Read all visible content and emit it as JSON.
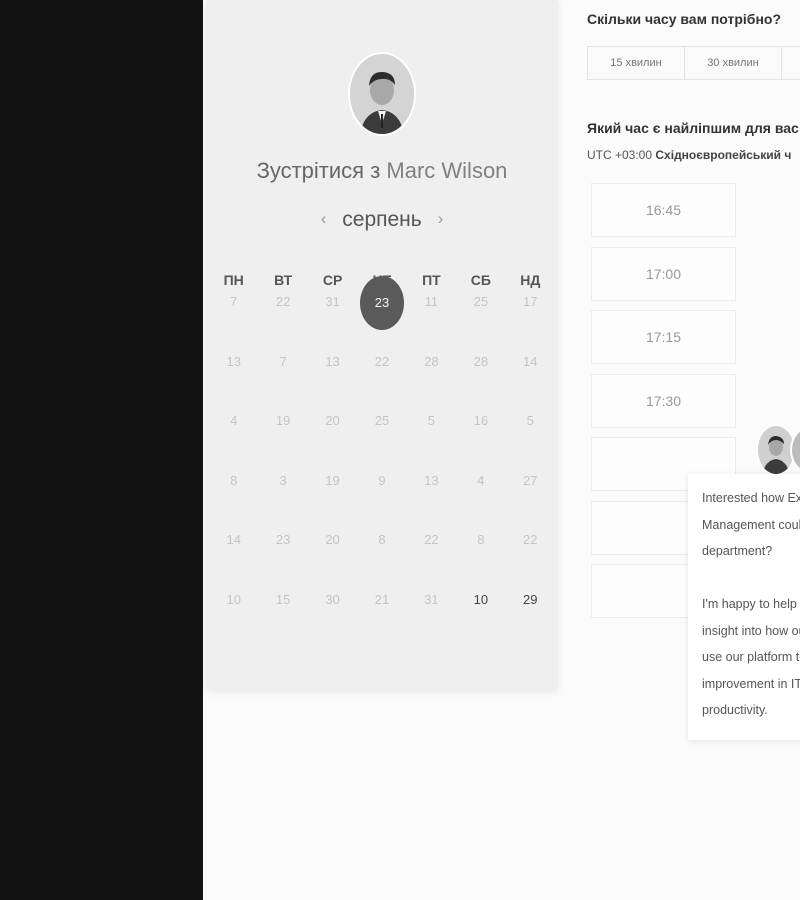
{
  "booking": {
    "title_prefix": "Зустрітися з",
    "host_name": "Marc Wilson",
    "month": "серпень",
    "prev_icon": "‹",
    "next_icon": "›"
  },
  "calendar": {
    "weekdays": [
      "ПН",
      "ВТ",
      "СР",
      "ЧТ",
      "ПТ",
      "СБ",
      "НД"
    ],
    "weeks": [
      [
        "7",
        "22",
        "31",
        "23",
        "11",
        "25",
        "17"
      ],
      [
        "13",
        "7",
        "13",
        "22",
        "28",
        "28",
        "14"
      ],
      [
        "4",
        "19",
        "20",
        "25",
        "5",
        "16",
        "5"
      ],
      [
        "8",
        "3",
        "19",
        "9",
        "13",
        "4",
        "27"
      ],
      [
        "14",
        "23",
        "20",
        "8",
        "22",
        "8",
        "22"
      ],
      [
        "10",
        "15",
        "30",
        "21",
        "31",
        "10",
        "29"
      ]
    ],
    "selected": "23"
  },
  "duration": {
    "question": "Скільки часу вам потрібно?",
    "options": [
      "15 хвилин",
      "30 хвилин"
    ]
  },
  "time": {
    "question": "Який час є найліпшим для вас",
    "timezone_offset": "UTC +03:00",
    "timezone_name": "Східноєвропейський ч",
    "slots": [
      "16:45",
      "17:00",
      "17:15",
      "17:30",
      "",
      "",
      ""
    ]
  },
  "chat": {
    "lines": [
      "Interested how Ex",
      "Management coul",
      "department?",
      "",
      "I'm happy to help",
      "insight into how ou",
      "use our platform to",
      "improvement in IT",
      "productivity."
    ]
  }
}
